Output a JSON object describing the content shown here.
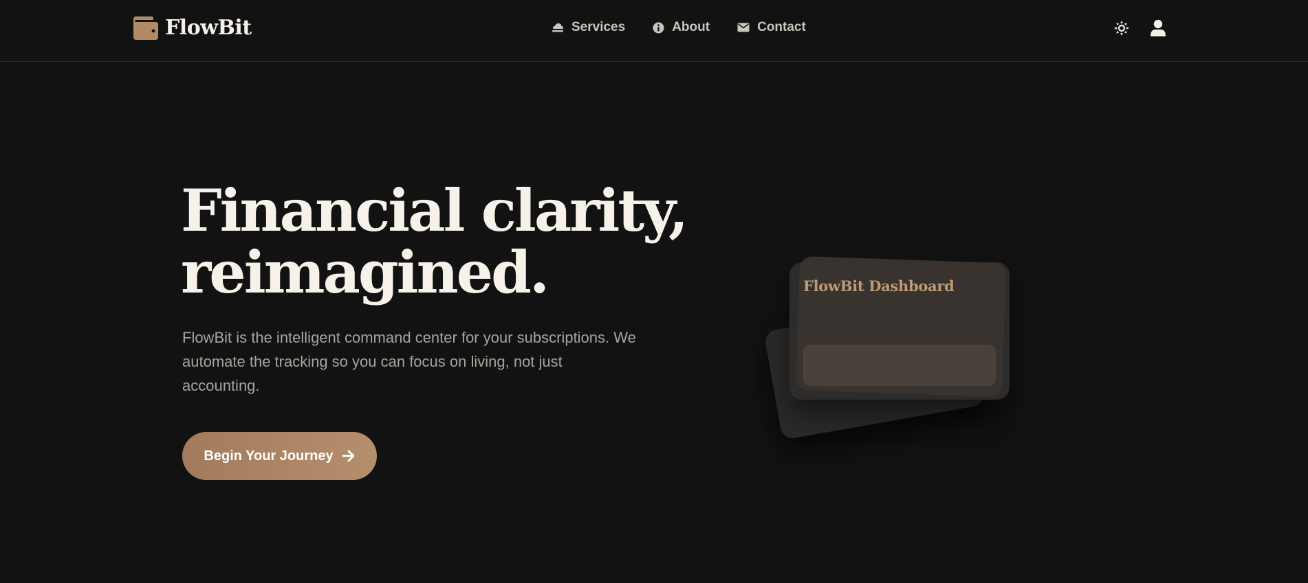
{
  "brand": {
    "name": "FlowBit",
    "icon": "wallet-icon",
    "accent": "#b28a68"
  },
  "nav": {
    "items": [
      {
        "label": "Services",
        "icon": "cloud-upload-icon"
      },
      {
        "label": "About",
        "icon": "info-circle-icon"
      },
      {
        "label": "Contact",
        "icon": "envelope-icon"
      }
    ]
  },
  "header_actions": {
    "theme_icon": "sun-icon",
    "account_icon": "user-icon"
  },
  "hero": {
    "title_line1": "Financial clarity,",
    "title_line2": "reimagined.",
    "description": "FlowBit is the intelligent command center for your subscriptions. We automate the tracking so you can focus on living, not just accounting.",
    "cta_label": "Begin Your Journey",
    "cta_icon": "arrow-right-icon"
  },
  "illustration": {
    "card_title": "FlowBit Dashboard"
  },
  "colors": {
    "background": "#121212",
    "text_primary": "#f7f2e9",
    "text_muted": "#a9a49c",
    "nav_text": "#c9c4bc",
    "cta_gradient_start": "#a37b5c",
    "cta_gradient_end": "#b58e6d"
  }
}
